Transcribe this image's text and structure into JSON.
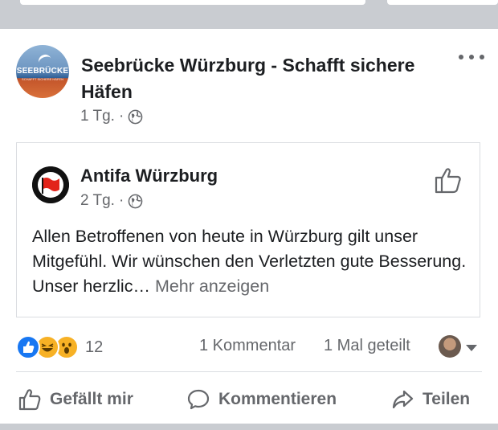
{
  "post": {
    "page_name": "Seebrücke Würzburg - Schafft sichere Häfen",
    "page_avatar_text": "SEEBRÜCKE",
    "page_avatar_subtext": "SCHAFFT SICHERE HÄFEN",
    "time": "1 Tg.",
    "separator": "·"
  },
  "shared_post": {
    "page_name": "Antifa Würzburg",
    "time": "2 Tg.",
    "separator": "·",
    "text": "Allen Betroffenen von heute in Würzburg gilt unser Mitgefühl. Wir wünschen den Verletzten gute Besserung. Unser herzlic…",
    "more_link": "Mehr anzeigen"
  },
  "stats": {
    "reactions": [
      "like-icon",
      "haha-icon",
      "wow-icon"
    ],
    "reaction_count": "12",
    "comments": "1 Kommentar",
    "shares": "1 Mal geteilt"
  },
  "actions": {
    "like": "Gefällt mir",
    "comment": "Kommentieren",
    "share": "Teilen"
  },
  "colors": {
    "facebook_blue": "#1877f2",
    "secondary_text": "#65676b",
    "antifa_red": "#e2231a"
  }
}
